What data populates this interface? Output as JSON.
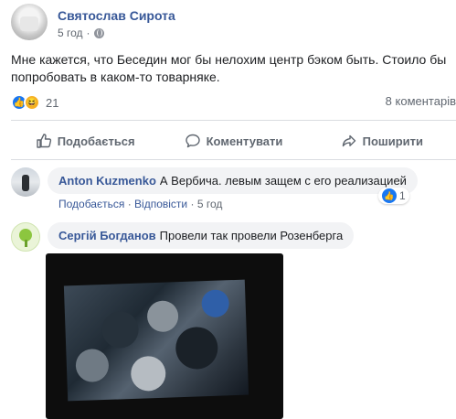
{
  "post": {
    "author": "Святослав Сирота",
    "time": "5 год",
    "text": "Мне кажется, что Беседин мог бы нелохим центр бэком быть. Стоило бы попробовать в каком-то товарняке.",
    "reaction_count": "21",
    "comments_count": "8 коментарів"
  },
  "actions": {
    "like": "Подобається",
    "comment": "Коментувати",
    "share": "Поширити"
  },
  "comments": [
    {
      "author": "Anton Kuzmenko",
      "text": "А Вербича. левым защем с его реализацией",
      "like_label": "Подобається",
      "reply_label": "Відповісти",
      "time": "5 год",
      "reactions": "1"
    },
    {
      "author": "Сергій Богданов",
      "text": "Провели так провели Розенберга"
    }
  ],
  "colors": {
    "link": "#385898",
    "like": "#1877f2",
    "muted": "#606770",
    "bubble": "#f2f3f5"
  }
}
